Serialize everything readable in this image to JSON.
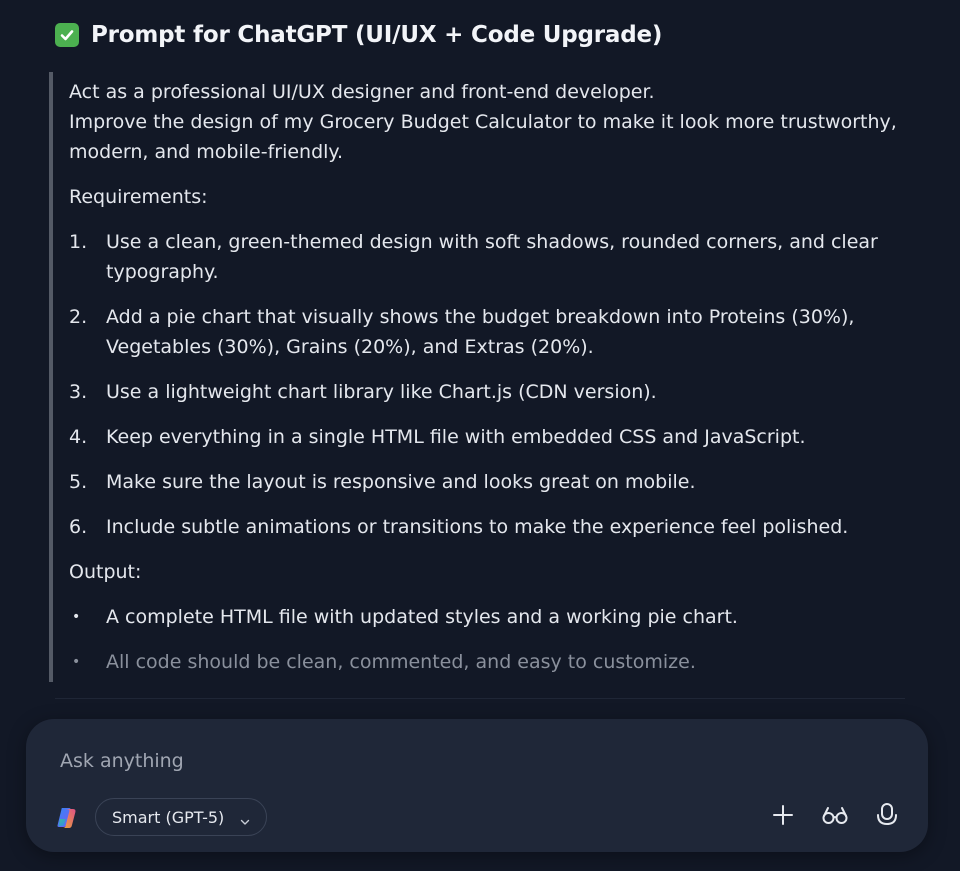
{
  "heading": {
    "title": "Prompt for ChatGPT (UI/UX + Code Upgrade)",
    "icon": "check-mark-button-icon",
    "icon_color": "#4cb050"
  },
  "prompt": {
    "intro_line1": "Act as a professional UI/UX designer and front-end developer.",
    "intro_line2": "Improve the design of my Grocery Budget Calculator to make it look more trustworthy,",
    "intro_line3": "modern, and mobile-friendly.",
    "requirements_label": "Requirements:",
    "requirements": [
      {
        "num": "1.",
        "line1": "Use a clean, green-themed design with soft shadows, rounded corners, and clear",
        "line2": "typography."
      },
      {
        "num": "2.",
        "line1": "Add a pie chart that visually shows the budget breakdown into Proteins (30%),",
        "line2": "Vegetables (30%), Grains (20%), and Extras (20%)."
      },
      {
        "num": "3.",
        "line1": "Use a lightweight chart library like Chart.js (CDN version)."
      },
      {
        "num": "4.",
        "line1": "Keep everything in a single HTML file with embedded CSS and JavaScript."
      },
      {
        "num": "5.",
        "line1": "Make sure the layout is responsive and looks great on mobile."
      },
      {
        "num": "6.",
        "line1": "Include subtle animations or transitions to make the experience feel polished."
      }
    ],
    "output_label": "Output:",
    "outputs": [
      {
        "bullet": "•",
        "text": "A complete HTML file with updated styles and a working pie chart."
      },
      {
        "bullet": "•",
        "text": "All code should be clean, commented, and easy to customize."
      }
    ]
  },
  "composer": {
    "placeholder": "Ask anything",
    "model_label": "Smart (GPT-5)",
    "icons": {
      "logo": "copilot-logo-icon",
      "model_chevron": "chevron-down-icon",
      "add": "plus-icon",
      "vision": "glasses-icon",
      "voice": "microphone-icon"
    }
  },
  "colors": {
    "background": "#121826",
    "composer_bg": "#1f2738",
    "quote_bar": "#545a66",
    "text": "#e4e7ed",
    "muted_text": "#8a909c"
  }
}
